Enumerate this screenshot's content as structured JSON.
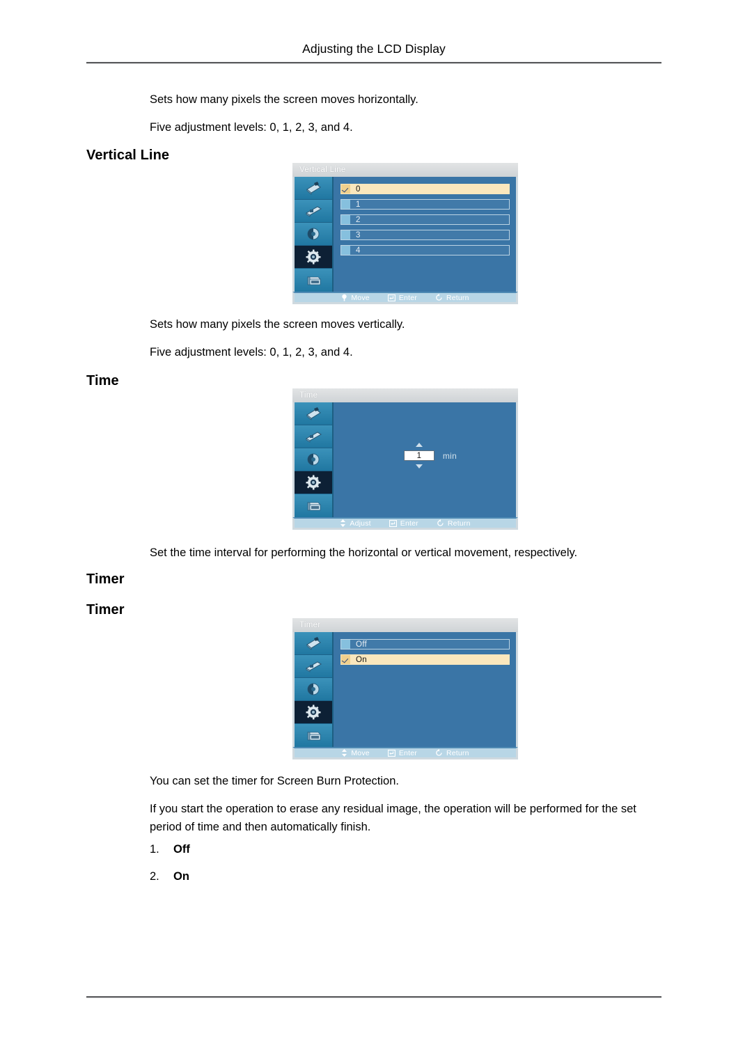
{
  "page": {
    "running_header": "Adjusting the LCD Display"
  },
  "sections": [
    {
      "intro_lines": [
        "Sets how many pixels the screen moves horizontally.",
        "Five adjustment levels: 0, 1, 2, 3, and 4."
      ],
      "heading": "Vertical Line",
      "osd": {
        "title": "Vertical Line",
        "kind": "list",
        "rows": [
          {
            "label": "0",
            "selected": true
          },
          {
            "label": "1",
            "selected": false
          },
          {
            "label": "2",
            "selected": false
          },
          {
            "label": "3",
            "selected": false
          },
          {
            "label": "4",
            "selected": false
          }
        ],
        "hints": [
          "Move",
          "Enter",
          "Return"
        ]
      },
      "after_lines": [
        "Sets how many pixels the screen moves vertically.",
        "Five adjustment levels: 0, 1, 2, 3, and 4."
      ]
    },
    {
      "heading": "Time",
      "osd": {
        "title": "Time",
        "kind": "spinner",
        "value": "1",
        "unit": "min",
        "hints": [
          "Adjust",
          "Enter",
          "Return"
        ]
      },
      "after_lines": [
        "Set the time interval for performing the horizontal or vertical movement, respectively."
      ]
    },
    {
      "heading": "Timer",
      "subheading": "Timer",
      "osd": {
        "title": "Timer",
        "kind": "list",
        "rows": [
          {
            "label": "Off",
            "selected": false
          },
          {
            "label": "On",
            "selected": true
          }
        ],
        "hints": [
          "Move",
          "Enter",
          "Return"
        ]
      },
      "after_lines": [
        "You can set the timer for Screen Burn Protection.",
        "If you start the operation to erase any residual image, the operation will be performed for the set period of time and then automatically finish."
      ],
      "numbered_list": [
        {
          "num": "1.",
          "value": "Off"
        },
        {
          "num": "2.",
          "value": "On"
        }
      ]
    }
  ],
  "sidebar_icons": [
    {
      "name": "input-source-icon",
      "selected": false
    },
    {
      "name": "picture-icon",
      "selected": false
    },
    {
      "name": "sound-icon",
      "selected": false
    },
    {
      "name": "setup-gear-icon",
      "selected": true
    },
    {
      "name": "multi-control-icon",
      "selected": false
    }
  ],
  "colors": {
    "osd_panel": "#3a75a6",
    "osd_sidebar": "#2b7fa8",
    "osd_selected_row": "#fae7bd",
    "osd_footer": "#b8d6e6",
    "rule": "#58595b"
  }
}
